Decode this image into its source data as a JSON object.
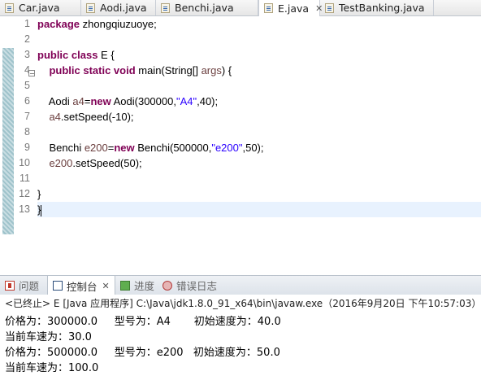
{
  "editor_tabs": [
    {
      "label": "Car.java"
    },
    {
      "label": "Aodi.java"
    },
    {
      "label": "Benchi.java"
    },
    {
      "label": "E.java",
      "close": "✕"
    },
    {
      "label": "TestBanking.java"
    }
  ],
  "editor": {
    "line_numbers": [
      "1",
      "2",
      "3",
      "4",
      "5",
      "6",
      "7",
      "8",
      "9",
      "10",
      "11",
      "12",
      "13"
    ],
    "code": {
      "l1_kw": "package",
      "l1_rest": " zhongqiuzuoye;",
      "l3_kw": "public class",
      "l3_rest": " E {",
      "l4_kw": "public static void",
      "l4_main": " main(String[] ",
      "l4_args": "args",
      "l4_end": ") {",
      "l6_a": "Aodi ",
      "l6_var": "a4",
      "l6_eq": "=",
      "l6_new": "new",
      "l6_ctor": " Aodi(300000,",
      "l6_str": "\"A4\"",
      "l6_end": ",40);",
      "l7_var": "a4",
      "l7_rest": ".setSpeed(-10);",
      "l9_a": "Benchi ",
      "l9_var": "e200",
      "l9_eq": "=",
      "l9_new": "new",
      "l9_ctor": " Benchi(500000,",
      "l9_str": "\"e200\"",
      "l9_end": ",50);",
      "l10_var": "e200",
      "l10_rest": ".setSpeed(50);",
      "l12": "}",
      "l13": "}"
    }
  },
  "console_tabs": [
    {
      "label": "问题"
    },
    {
      "label": "控制台",
      "close": "✕"
    },
    {
      "label": "进度"
    },
    {
      "label": "错误日志"
    }
  ],
  "console": {
    "terminated": "<已终止> E [Java 应用程序] C:\\Java\\jdk1.8.0_91_x64\\bin\\javaw.exe（2016年9月20日 下午10:57:03）",
    "output": [
      "价格为：300000.0     型号为：A4       初始速度为：40.0",
      "当前车速为：30.0",
      "价格为：500000.0     型号为：e200   初始速度为：50.0",
      "当前车速为：100.0"
    ]
  }
}
